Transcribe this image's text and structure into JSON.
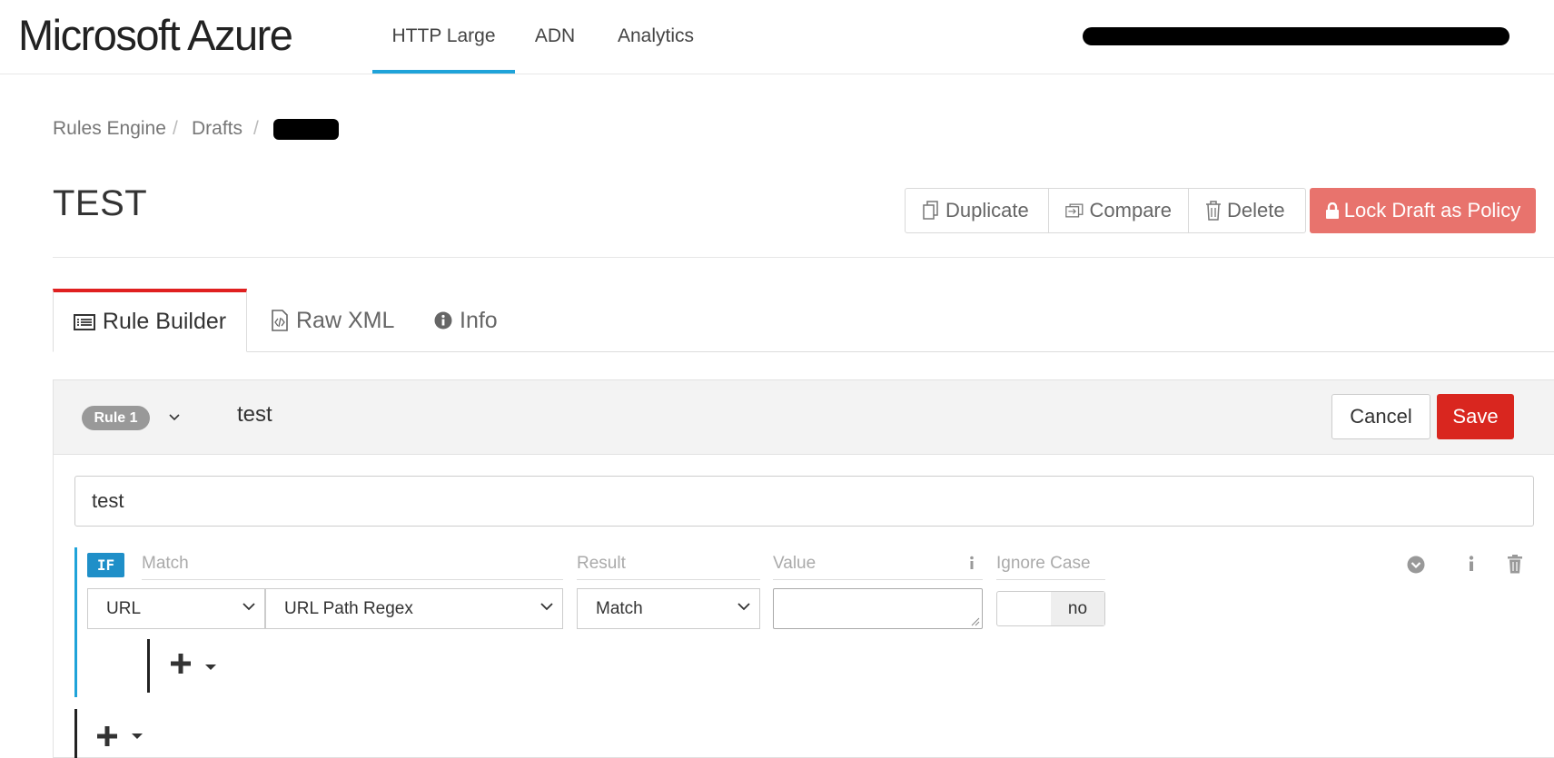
{
  "header": {
    "brand": "Microsoft Azure",
    "nav": [
      {
        "label": "HTTP Large",
        "active": true
      },
      {
        "label": "ADN",
        "active": false
      },
      {
        "label": "Analytics",
        "active": false
      }
    ]
  },
  "breadcrumb": {
    "items": [
      "Rules Engine",
      "Drafts"
    ],
    "separator": "/"
  },
  "page": {
    "title": "TEST"
  },
  "actions": {
    "duplicate": "Duplicate",
    "compare": "Compare",
    "delete": "Delete",
    "lock": "Lock Draft as Policy"
  },
  "tabs": [
    {
      "label": "Rule Builder",
      "icon": "list-icon",
      "active": true
    },
    {
      "label": "Raw XML",
      "icon": "code-file-icon",
      "active": false
    },
    {
      "label": "Info",
      "icon": "info-circle-icon",
      "active": false
    }
  ],
  "rule": {
    "badge": "Rule 1",
    "name": "test",
    "cancel": "Cancel",
    "save": "Save",
    "description": "test",
    "condition": {
      "if_label": "IF",
      "match_label": "Match",
      "result_label": "Result",
      "value_label": "Value",
      "ignore_case_label": "Ignore Case",
      "match_type": "URL",
      "match_subtype": "URL Path Regex",
      "result": "Match",
      "value": "",
      "ignore_case": "no"
    }
  },
  "colors": {
    "accent_blue": "#1fa3d9",
    "tab_red": "#e02020",
    "lock_button": "#e8736d",
    "save_button": "#d9261f"
  }
}
